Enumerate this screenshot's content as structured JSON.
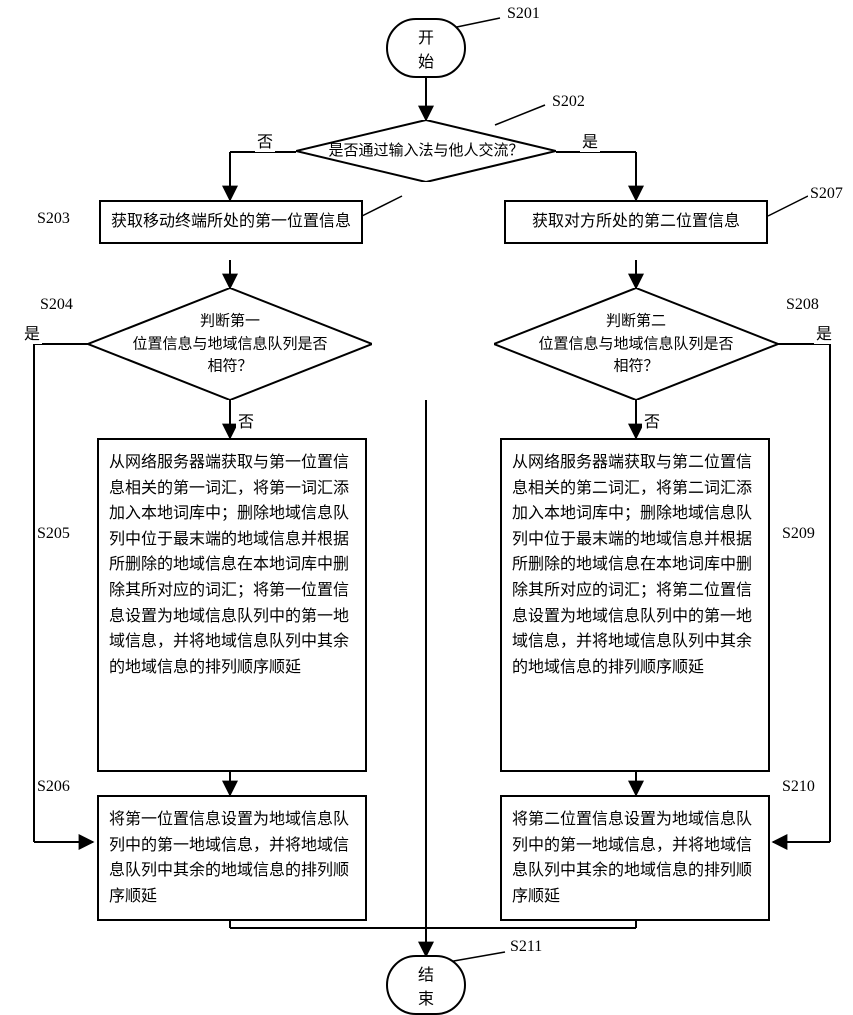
{
  "s201": {
    "tag": "S201",
    "text": "开始"
  },
  "s202": {
    "tag": "S202",
    "text": "是否通过输入法与他人交流？"
  },
  "s203": {
    "tag": "S203",
    "text": "获取移动终端所处的第一位置信息"
  },
  "s207": {
    "tag": "S207",
    "text": "获取对方所处的第二位置信息"
  },
  "s204": {
    "tag": "S204",
    "line1": "判断第一",
    "line2": "位置信息与地域信息队列是否",
    "line3": "相符？"
  },
  "s208": {
    "tag": "S208",
    "line1": "判断第二",
    "line2": "位置信息与地域信息队列是否",
    "line3": "相符？"
  },
  "s205": {
    "tag": "S205",
    "text": "从网络服务器端获取与第一位置信息相关的第一词汇，将第一词汇添加入本地词库中；删除地域信息队列中位于最末端的地域信息并根据所删除的地域信息在本地词库中删除其所对应的词汇；将第一位置信息设置为地域信息队列中的第一地域信息，并将地域信息队列中其余的地域信息的排列顺序顺延"
  },
  "s209": {
    "tag": "S209",
    "text": "从网络服务器端获取与第二位置信息相关的第二词汇，将第二词汇添加入本地词库中；删除地域信息队列中位于最末端的地域信息并根据所删除的地域信息在本地词库中删除其所对应的词汇；将第二位置信息设置为地域信息队列中的第一地域信息，并将地域信息队列中其余的地域信息的排列顺序顺延"
  },
  "s206": {
    "tag": "S206",
    "text": "将第一位置信息设置为地域信息队列中的第一地域信息，并将地域信息队列中其余的地域信息的排列顺序顺延"
  },
  "s210": {
    "tag": "S210",
    "text": "将第二位置信息设置为地域信息队列中的第一地域信息，并将地域信息队列中其余的地域信息的排列顺序顺延"
  },
  "s211": {
    "tag": "S211",
    "text": "结束"
  },
  "yn": {
    "yes": "是",
    "no": "否"
  }
}
